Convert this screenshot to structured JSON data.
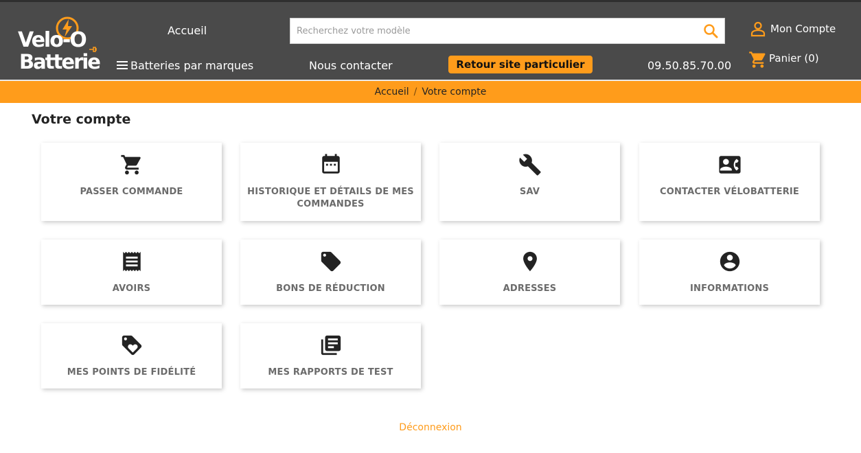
{
  "header": {
    "logo": {
      "line1": "Velo-O",
      "line2": "Batterie"
    },
    "nav": {
      "home": "Accueil",
      "brands": "Batteries par marques",
      "contact": "Nous contacter"
    },
    "search": {
      "placeholder": "Recherchez votre modèle",
      "value": ""
    },
    "retour_button": "Retour site particulier",
    "phone": "09.50.85.70.00",
    "account_label": "Mon Compte",
    "cart_label": "Panier (0)",
    "colors": {
      "background": "#4a4a4a",
      "accent": "#ff9c1b"
    }
  },
  "breadcrumb": {
    "items": [
      "Accueil",
      "Votre compte"
    ],
    "separator": "/"
  },
  "page": {
    "title": "Votre compte",
    "tiles": [
      {
        "label": "PASSER COMMANDE",
        "icon": "shopping-cart-icon"
      },
      {
        "label": "HISTORIQUE ET DÉTAILS DE MES COMMANDES",
        "icon": "calendar-icon"
      },
      {
        "label": "SAV",
        "icon": "wrench-icon"
      },
      {
        "label": "CONTACTER VÉLOBATTERIE",
        "icon": "contact-card-icon"
      },
      {
        "label": "AVOIRS",
        "icon": "receipt-icon"
      },
      {
        "label": "BONS DE RÉDUCTION",
        "icon": "tag-icon"
      },
      {
        "label": "ADRESSES",
        "icon": "location-pin-icon"
      },
      {
        "label": "INFORMATIONS",
        "icon": "account-circle-icon"
      },
      {
        "label": "MES POINTS DE FIDÉLITÉ",
        "icon": "loyalty-tag-icon"
      },
      {
        "label": "MES RAPPORTS DE TEST",
        "icon": "library-books-icon"
      }
    ],
    "logout": "Déconnexion"
  }
}
